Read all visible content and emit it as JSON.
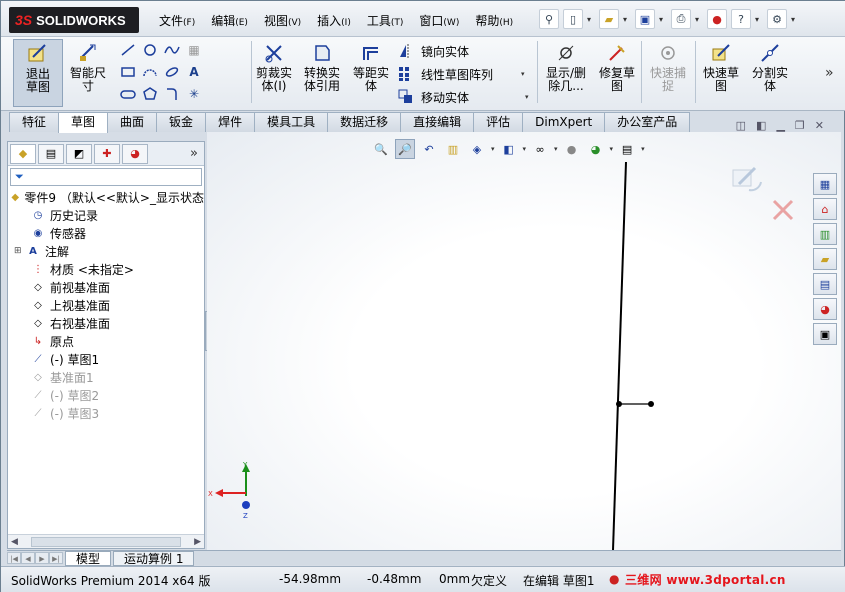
{
  "app": {
    "logo_text": "SOLIDWORKS",
    "logo_prefix": "3S"
  },
  "menu": [
    {
      "label": "文件",
      "key": "(F)"
    },
    {
      "label": "编辑",
      "key": "(E)"
    },
    {
      "label": "视图",
      "key": "(V)"
    },
    {
      "label": "插入",
      "key": "(I)"
    },
    {
      "label": "工具",
      "key": "(T)"
    },
    {
      "label": "窗口",
      "key": "(W)"
    },
    {
      "label": "帮助",
      "key": "(H)"
    }
  ],
  "commands": {
    "exit_sketch": "退出草图",
    "smart_dimension": "智能尺寸",
    "trim": "剪裁实体(I)",
    "convert": "转换实体引用",
    "offset": "等距实体",
    "mirror": "镜向实体",
    "linear_pattern": "线性草图阵列",
    "move": "移动实体",
    "display_delete": "显示/删除几...",
    "repair": "修复草图",
    "quick_snaps": "快速捕捉",
    "rapid_sketch": "快速草图",
    "split": "分割实体"
  },
  "tabs": [
    "特征",
    "草图",
    "曲面",
    "钣金",
    "焊件",
    "模具工具",
    "数据迁移",
    "直接编辑",
    "评估",
    "DimXpert",
    "办公室产品"
  ],
  "active_tab": "草图",
  "tree": {
    "root": "零件9 （默认<<默认>_显示状态",
    "items": [
      {
        "label": "历史记录",
        "icon": "history-icon",
        "state": "normal"
      },
      {
        "label": "传感器",
        "icon": "sensor-icon",
        "state": "normal"
      },
      {
        "label": "注解",
        "icon": "annotation-icon",
        "state": "normal",
        "expandable": true
      },
      {
        "label": "材质 <未指定>",
        "icon": "material-icon",
        "state": "normal"
      },
      {
        "label": "前视基准面",
        "icon": "plane-icon",
        "state": "normal"
      },
      {
        "label": "上视基准面",
        "icon": "plane-icon",
        "state": "normal"
      },
      {
        "label": "右视基准面",
        "icon": "plane-icon",
        "state": "normal"
      },
      {
        "label": "原点",
        "icon": "origin-icon",
        "state": "normal"
      },
      {
        "label": "(-) 草图1",
        "icon": "sketch-icon",
        "state": "normal"
      },
      {
        "label": "基准面1",
        "icon": "plane-icon",
        "state": "gray"
      },
      {
        "label": "(-) 草图2",
        "icon": "sketch-icon",
        "state": "gray"
      },
      {
        "label": "(-) 草图3",
        "icon": "sketch-icon",
        "state": "gray"
      }
    ]
  },
  "bottom_tabs": [
    "模型",
    "运动算例 1"
  ],
  "status": {
    "product": "SolidWorks Premium 2014 x64 版",
    "x": "-54.98mm",
    "y": "-0.48mm",
    "z": "0mm",
    "definition": "欠定义",
    "editing": "在编辑 草图1",
    "watermark": "三维网 www.3dportal.cn"
  },
  "triad": {
    "x": "X",
    "y": "Y",
    "z": "Z"
  },
  "colors": {
    "accent": "#1f5fbf",
    "watermark": "#e5151c",
    "triad_x": "#d22",
    "triad_y": "#1a8f1a",
    "triad_z": "#1d3fbf"
  }
}
